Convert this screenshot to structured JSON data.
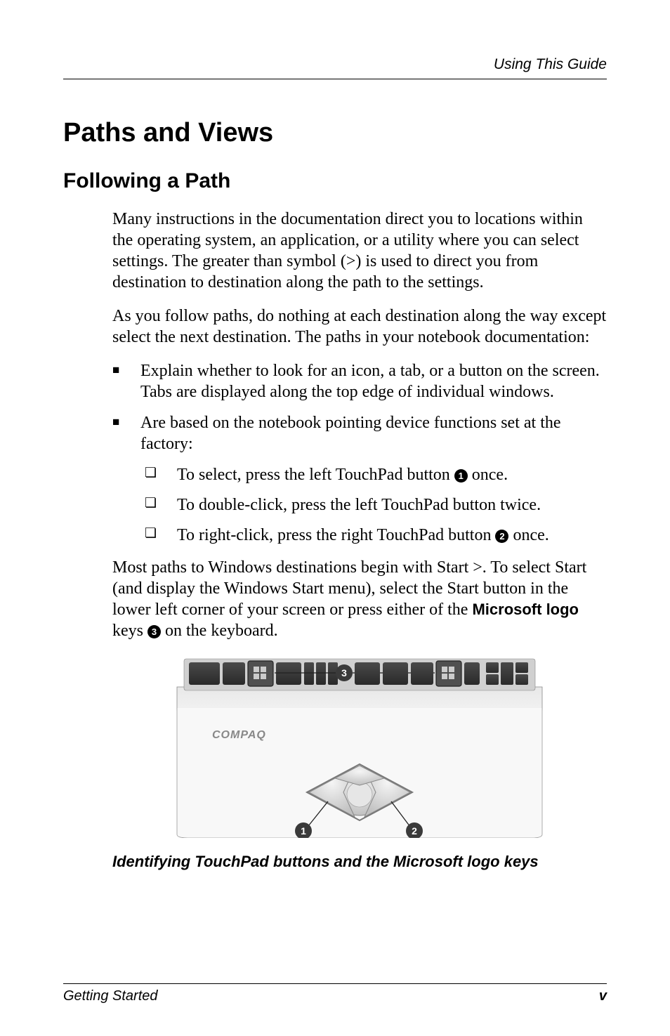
{
  "header": {
    "running_title": "Using This Guide"
  },
  "headings": {
    "h1": "Paths and Views",
    "h2": "Following a Path"
  },
  "paragraphs": {
    "p1": "Many instructions in the documentation direct you to locations within the operating system, an application, or a utility where you can select settings. The greater than symbol (>) is used to direct you from destination to destination along the path to the settings.",
    "p2": "As you follow paths, do nothing at each destination along the way except select the next destination. The paths in your notebook documentation:"
  },
  "bullets": {
    "b1": "Explain whether to look for an icon, a tab, or a button on the screen. Tabs are displayed along the top edge of individual windows.",
    "b2": "Are based on the notebook pointing device functions set at the factory:",
    "sb1_pre": "To select, press the left TouchPad button ",
    "sb1_post": " once.",
    "sb2": "To double-click, press the left TouchPad button twice.",
    "sb3_pre": "To right-click, press the right TouchPad button ",
    "sb3_post": " once."
  },
  "paragraph_after": {
    "pre": "Most paths to Windows destinations begin with Start >. To select Start (and display the Windows Start menu), select the Start button in the lower left corner of your screen or press either of the ",
    "bold": "Microsoft logo",
    "mid": " keys ",
    "post": " on the keyboard."
  },
  "circled": {
    "n1": "1",
    "n2": "2",
    "n3": "3"
  },
  "figure": {
    "brand": "COMPAQ",
    "caption": "Identifying TouchPad buttons and the Microsoft logo keys"
  },
  "footer": {
    "left": "Getting Started",
    "right": "v"
  }
}
